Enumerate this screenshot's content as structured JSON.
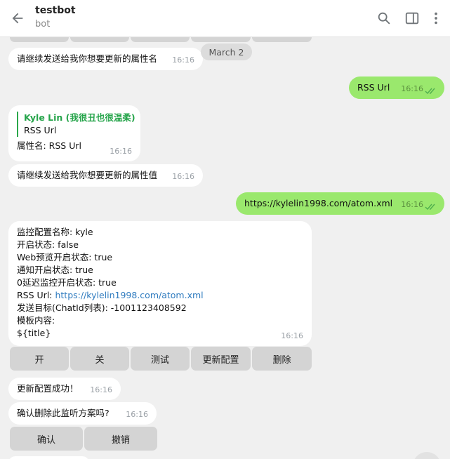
{
  "header": {
    "title": "testbot",
    "subtitle": "bot"
  },
  "date_divider": "March 2",
  "messages": {
    "m1": {
      "text": "请继续发送给我你想要更新的属性名",
      "time": "16:16"
    },
    "m2": {
      "text": "RSS Url",
      "time": "16:16"
    },
    "m3": {
      "reply_author": "Kyle Lin (我很丑也很温柔)",
      "reply_text": "RSS Url",
      "text": "属性名: RSS Url",
      "time": "16:16"
    },
    "m4": {
      "text": "请继续发送给我你想要更新的属性值",
      "time": "16:16"
    },
    "m5": {
      "text": "https://kylelin1998.com/atom.xml",
      "time": "16:16"
    },
    "m6": {
      "l1": "监控配置名称: kyle",
      "l2": "开启状态: false",
      "l3": "Web预览开启状态: true",
      "l4": "通知开启状态: true",
      "l5": "0延迟监控开启状态: true",
      "l6_label": "RSS Url: ",
      "l6_link": "https://kylelin1998.com/atom.xml",
      "l7": "发送目标(ChatId列表): -1001123408592",
      "l8": "模板内容:",
      "l9": "${title}",
      "time": "16:16"
    },
    "m7": {
      "text": "更新配置成功！",
      "time": "16:16"
    },
    "m8": {
      "text": "确认删除此监听方案吗?",
      "time": "16:16"
    }
  },
  "keyboard1": {
    "open": "开",
    "close": "关",
    "test": "测试",
    "update": "更新配置",
    "delete": "删除"
  },
  "keyboard2": {
    "confirm": "确认",
    "cancel": "撤销"
  },
  "colors": {
    "outgoing": "#9ae86d",
    "incoming": "#ffffff",
    "background": "#f0f0f0",
    "link": "#2f7bbf",
    "reply_accent": "#25a44a"
  }
}
